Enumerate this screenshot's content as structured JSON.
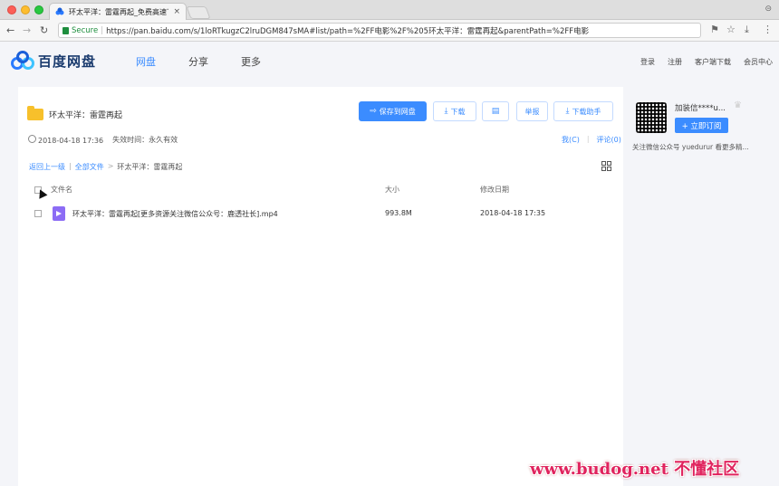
{
  "browser": {
    "tab_title": "环太平洋：雷霆再起_免费高速下",
    "tab_close": "×",
    "secure_label": "Secure",
    "url": "https://pan.baidu.com/s/1loRTkugzC2lruDGM847sMA#list/path=%2FF电影%2F%205环太平洋：雷霆再起&parentPath=%2FF电影",
    "corner": "⊝"
  },
  "site": {
    "logo_text": "百度网盘",
    "nav": [
      "网盘",
      "分享",
      "更多"
    ],
    "header_links": [
      "登录",
      "注册",
      "客户端下载",
      "会员中心"
    ]
  },
  "share": {
    "title": "环太平洋：雷霆再起",
    "date": "2018-04-18 17:36",
    "expire_label": "失效时间：永久有效",
    "save_btn": "保存到网盘",
    "download_btn": "下载",
    "report_btn": "举报",
    "helper_btn": "下载助手",
    "links": [
      "我(C)",
      "评论(0)"
    ]
  },
  "breadcrumb": {
    "back": "返回上一级",
    "all": "全部文件",
    "current": "环太平洋：雷霆再起"
  },
  "table": {
    "headers": [
      "文件名",
      "大小",
      "修改日期"
    ],
    "rows": [
      {
        "name": "环太平洋：雷霆再起[更多资源关注微信公众号：鹿透社长].mp4",
        "size": "993.8M",
        "date": "2018-04-18 17:35"
      }
    ]
  },
  "profile": {
    "name": "加装信****u...",
    "subscribe": "+ 立即订阅",
    "desc": "关注微信公众号 yuedurur 看更多精..."
  },
  "watermark": "www.budog.net 不懂社区",
  "colors": {
    "accent": "#3b8cff",
    "folder": "#f7c02b",
    "video": "#8c6cf5",
    "watermark": "#e0245e"
  }
}
